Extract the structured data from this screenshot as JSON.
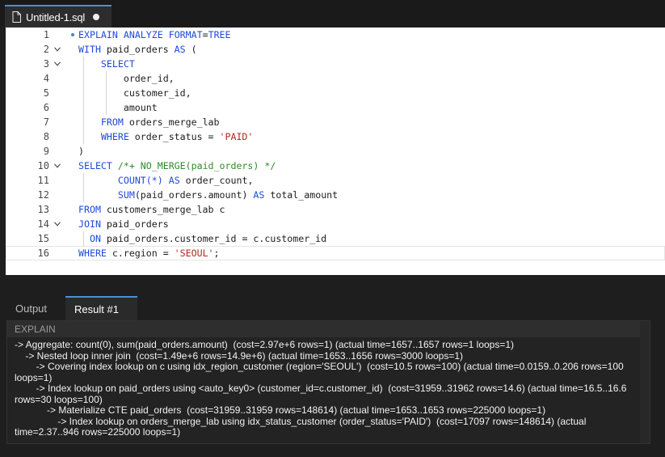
{
  "editor_tab": {
    "title": "Untitled-1.sql",
    "dirty_indicator": "●"
  },
  "editor": {
    "lines": [
      {
        "num": "1",
        "fold": false,
        "modified": true,
        "code": "EXPLAIN ANALYZE FORMAT=TREE"
      },
      {
        "num": "2",
        "fold": true,
        "code": "WITH paid_orders AS ("
      },
      {
        "num": "3",
        "fold": true,
        "code": "    SELECT"
      },
      {
        "num": "4",
        "fold": false,
        "code": "        order_id,"
      },
      {
        "num": "5",
        "fold": false,
        "code": "        customer_id,"
      },
      {
        "num": "6",
        "fold": false,
        "code": "        amount"
      },
      {
        "num": "7",
        "fold": false,
        "code": "    FROM orders_merge_lab"
      },
      {
        "num": "8",
        "fold": false,
        "code": "    WHERE order_status = 'PAID'"
      },
      {
        "num": "9",
        "fold": false,
        "code": ")"
      },
      {
        "num": "10",
        "fold": true,
        "code": "SELECT /*+ NO_MERGE(paid_orders) */"
      },
      {
        "num": "11",
        "fold": false,
        "code": "       COUNT(*) AS order_count,"
      },
      {
        "num": "12",
        "fold": false,
        "code": "       SUM(paid_orders.amount) AS total_amount"
      },
      {
        "num": "13",
        "fold": false,
        "code": "FROM customers_merge_lab c"
      },
      {
        "num": "14",
        "fold": true,
        "code": "JOIN paid_orders"
      },
      {
        "num": "15",
        "fold": false,
        "code": "  ON paid_orders.customer_id = c.customer_id"
      },
      {
        "num": "16",
        "fold": false,
        "active": true,
        "code": "WHERE c.region = 'SEOUL';"
      }
    ]
  },
  "panel": {
    "tabs": [
      {
        "label": "Output",
        "active": false
      },
      {
        "label": "Result #1",
        "active": true
      }
    ],
    "column_header": "EXPLAIN",
    "result_lines": [
      "-> Aggregate: count(0), sum(paid_orders.amount)  (cost=2.97e+6 rows=1) (actual time=1657..1657 rows=1 loops=1)",
      "    -> Nested loop inner join  (cost=1.49e+6 rows=14.9e+6) (actual time=1653..1656 rows=3000 loops=1)",
      "        -> Covering index lookup on c using idx_region_customer (region='SEOUL')  (cost=10.5 rows=100) (actual time=0.0159..0.206 rows=100 loops=1)",
      "        -> Index lookup on paid_orders using <auto_key0> (customer_id=c.customer_id)  (cost=31959..31962 rows=14.6) (actual time=16.5..16.6 rows=30 loops=100)",
      "            -> Materialize CTE paid_orders  (cost=31959..31959 rows=148614) (actual time=1653..1653 rows=225000 loops=1)",
      "                -> Index lookup on orders_merge_lab using idx_status_customer (order_status='PAID')  (cost=17097 rows=148614) (actual time=2.37..946 rows=225000 loops=1)"
    ]
  },
  "colors": {
    "keyword": "#1f49d8",
    "string": "#b3271f",
    "comment": "#2e8a2a",
    "accent": "#4a8fd8"
  }
}
